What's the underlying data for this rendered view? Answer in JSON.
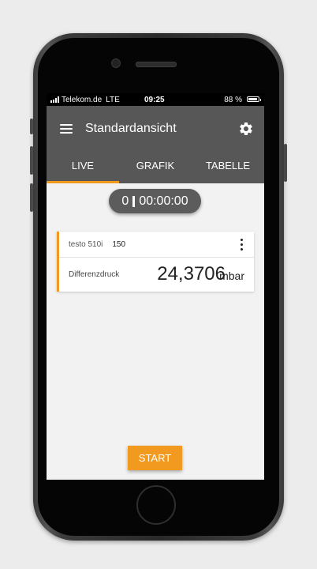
{
  "status_bar": {
    "carrier": "Telekom.de",
    "network": "LTE",
    "time": "09:25",
    "battery": "88 %",
    "battery_level": 0.88
  },
  "app_bar": {
    "title": "Standardansicht",
    "menu_icon": "hamburger-menu-icon",
    "settings_icon": "gear-icon"
  },
  "tabs": [
    {
      "label": "LIVE",
      "active": true
    },
    {
      "label": "GRAFIK",
      "active": false
    },
    {
      "label": "TABELLE",
      "active": false
    }
  ],
  "timer": {
    "count": "0",
    "time": "00:00:00"
  },
  "measurement_card": {
    "device_name": "testo 510i",
    "device_value": "150",
    "label": "Differenzdruck",
    "value": "24,3706",
    "unit": "mbar"
  },
  "start_button": {
    "label": "START"
  },
  "colors": {
    "accent": "#f29a1f",
    "app_bar": "#575757",
    "background": "#f2f2f2"
  }
}
